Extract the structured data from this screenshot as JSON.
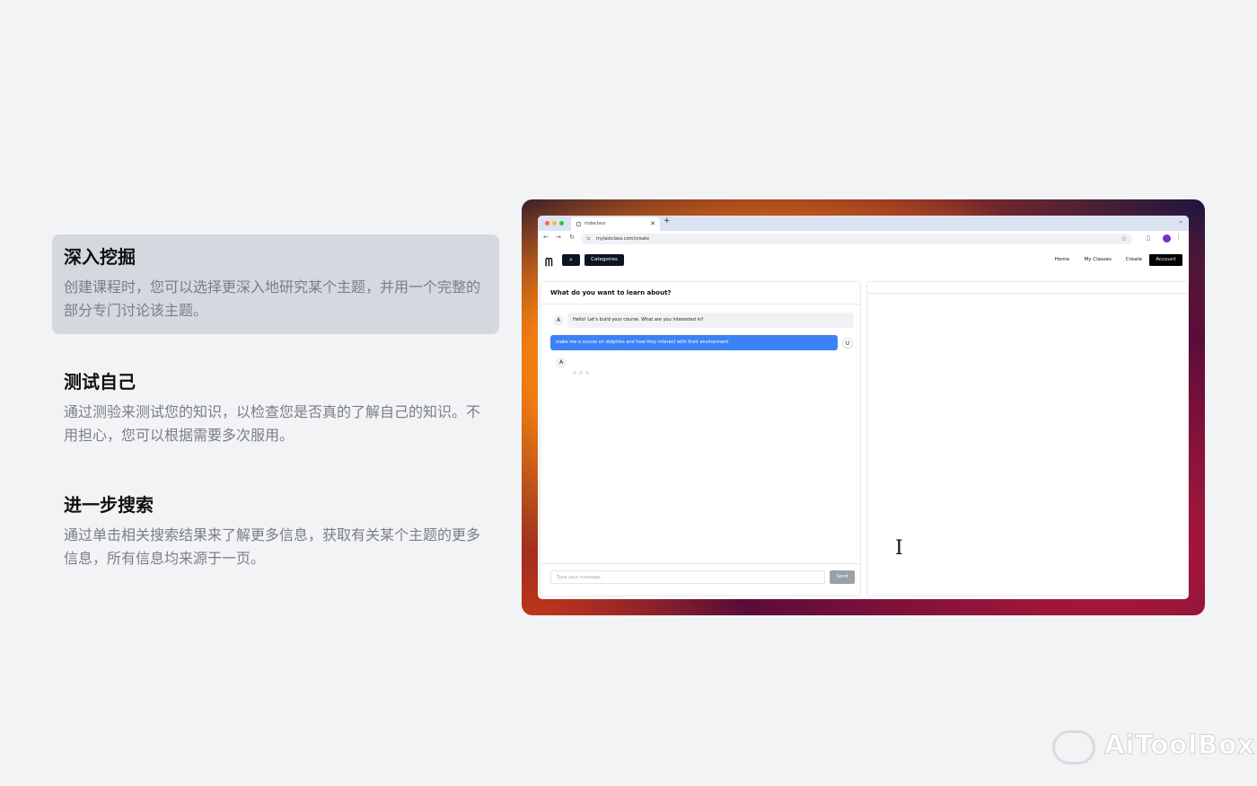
{
  "features": [
    {
      "title": "深入挖掘",
      "desc": "创建课程时，您可以选择更深入地研究某个主题，并用一个完整的部分专门讨论该主题。"
    },
    {
      "title": "测试自己",
      "desc": "通过测验来测试您的知识，以检查您是否真的了解自己的知识。不用担心，您可以根据需要多次服用。"
    },
    {
      "title": "进一步搜索",
      "desc": "通过单击相关搜索结果来了解更多信息，获取有关某个主题的更多信息，所有信息均来源于一页。"
    }
  ],
  "browser": {
    "tab_title": "mdaclass",
    "url": "mylastclass.com/create"
  },
  "app": {
    "categories_label": "Categories",
    "nav": {
      "home": "Home",
      "my_classes": "My Classes",
      "create": "Create",
      "account": "Account"
    },
    "chat_title": "What do you want to learn about?",
    "bot_avatar": "A",
    "bot_message": "Hello! Let's build your course. What are you interested in?",
    "user_message": "make me a course on dolphins and how they interact with their environment",
    "user_avatar": "U",
    "input_placeholder": "Type your message...",
    "send_label": "Send"
  },
  "watermark": "AiToolBox",
  "colors": {
    "primary": "#0d1426",
    "accent": "#3b82f6",
    "highlight": "#d5d8de"
  }
}
